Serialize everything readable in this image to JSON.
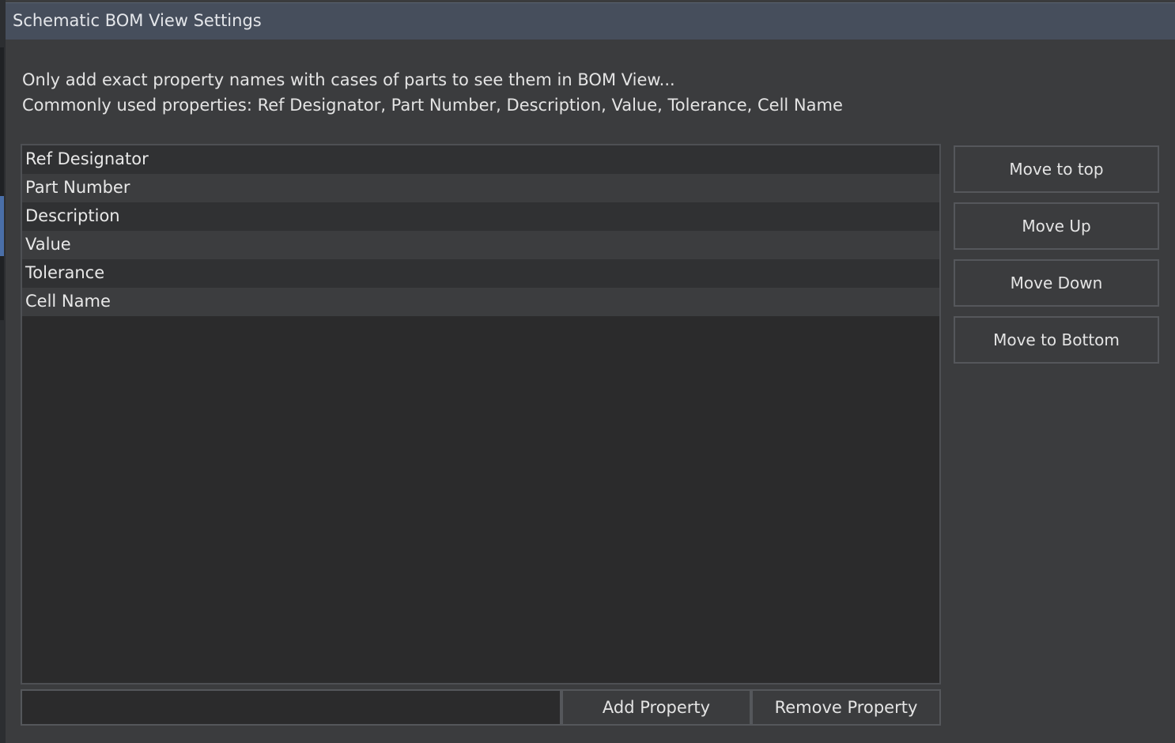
{
  "window": {
    "title": "Schematic BOM View Settings"
  },
  "hints": {
    "line1": "Only add exact property names with cases of parts to see them in BOM View...",
    "line2": "Commonly used properties: Ref Designator, Part Number, Description, Value, Tolerance, Cell Name"
  },
  "properties": [
    "Ref Designator",
    "Part Number",
    "Description",
    "Value",
    "Tolerance",
    "Cell Name"
  ],
  "side_buttons": {
    "move_top": "Move to top",
    "move_up": "Move Up",
    "move_down": "Move Down",
    "move_bottom": "Move to Bottom"
  },
  "property_input": {
    "value": "",
    "placeholder": ""
  },
  "bottom_buttons": {
    "add": "Add Property",
    "remove": "Remove Property"
  }
}
